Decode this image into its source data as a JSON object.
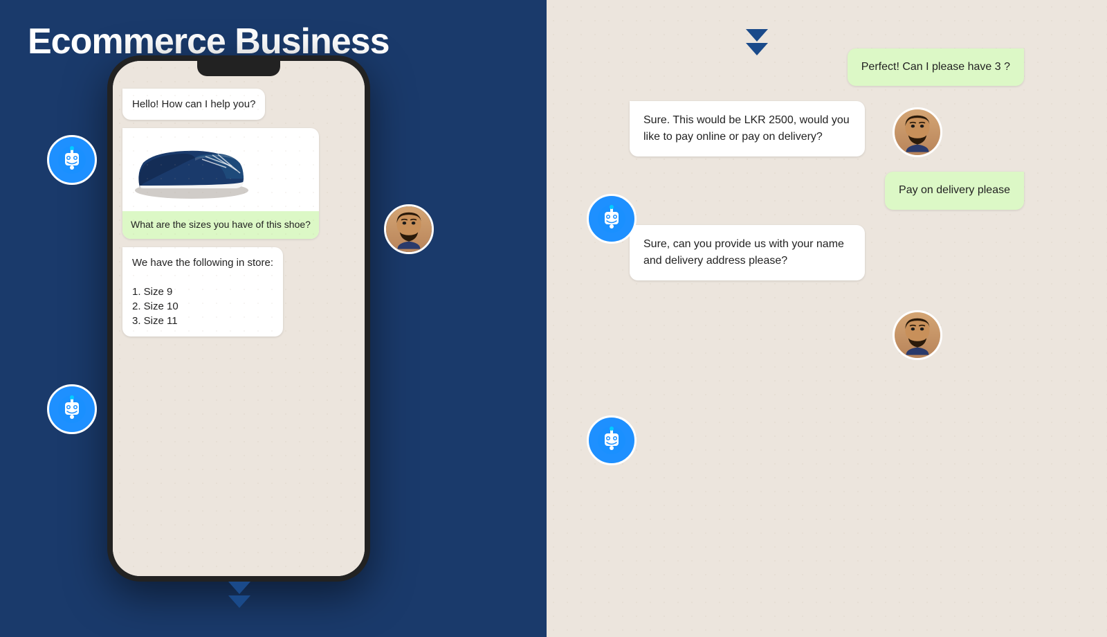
{
  "page": {
    "title": "Ecommerce Business",
    "background_color": "#1a3a6b"
  },
  "left_phone": {
    "messages": [
      {
        "type": "bot",
        "text": "Hello! How can I help you?"
      },
      {
        "type": "user_image",
        "caption": "What are the sizes you have of this shoe?"
      },
      {
        "type": "bot",
        "text": "We have the following in store:\n\n1. Size 9\n2. Size 10\n3. Size 11"
      }
    ]
  },
  "right_panel": {
    "messages": [
      {
        "type": "user",
        "text": "Perfect! Can I please have 3 ?"
      },
      {
        "type": "bot",
        "text": "Sure. This would be LKR 2500, would you like to pay online or pay on delivery?"
      },
      {
        "type": "user",
        "text": "Pay on delivery please"
      },
      {
        "type": "bot",
        "text": "Sure, can you provide us with your name and delivery address please?"
      }
    ]
  },
  "avatars": {
    "bot_label": "bot avatar",
    "human_label": "human avatar"
  }
}
